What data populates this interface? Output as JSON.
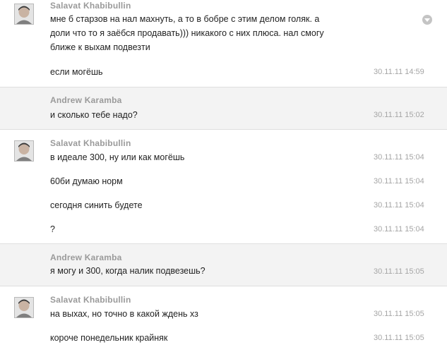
{
  "thread": {
    "menu_icon": "chevron-down-icon",
    "colors": {
      "alt_row": "#f3f3f3",
      "author": "#9a9a9a",
      "time": "#a5a5a5"
    },
    "groups": [
      {
        "author": "Salavat Khabibullin",
        "messages": [
          {
            "text": "мне б старзов на нал махнуть, а то в бобре с этим делом голяк. а\nдоли что то я заёбся продавать))) никакого с них плюса. нал смогу\nближе к выхам подвезти",
            "time": ""
          },
          {
            "text": "если могёшь",
            "time": "30.11.11 14:59"
          }
        ]
      },
      {
        "author": "Andrew Karamba",
        "messages": [
          {
            "text": "и сколько тебе надо?",
            "time": "30.11.11 15:02"
          }
        ]
      },
      {
        "author": "Salavat Khabibullin",
        "messages": [
          {
            "text": "в идеале 300, ну или как могёшь",
            "time": "30.11.11 15:04"
          },
          {
            "text": "60би думаю норм",
            "time": "30.11.11 15:04"
          },
          {
            "text": "сегодня синить будете",
            "time": "30.11.11 15:04"
          },
          {
            "text": "?",
            "time": "30.11.11 15:04"
          }
        ]
      },
      {
        "author": "Andrew Karamba",
        "messages": [
          {
            "text": "я могу и 300, когда налик подвезешь?",
            "time": "30.11.11 15:05"
          }
        ]
      },
      {
        "author": "Salavat Khabibullin",
        "messages": [
          {
            "text": "на выхах, но точно в какой ждень хз",
            "time": "30.11.11 15:05"
          },
          {
            "text": "короче понедельник крайняк",
            "time": "30.11.11 15:05"
          }
        ]
      }
    ]
  }
}
